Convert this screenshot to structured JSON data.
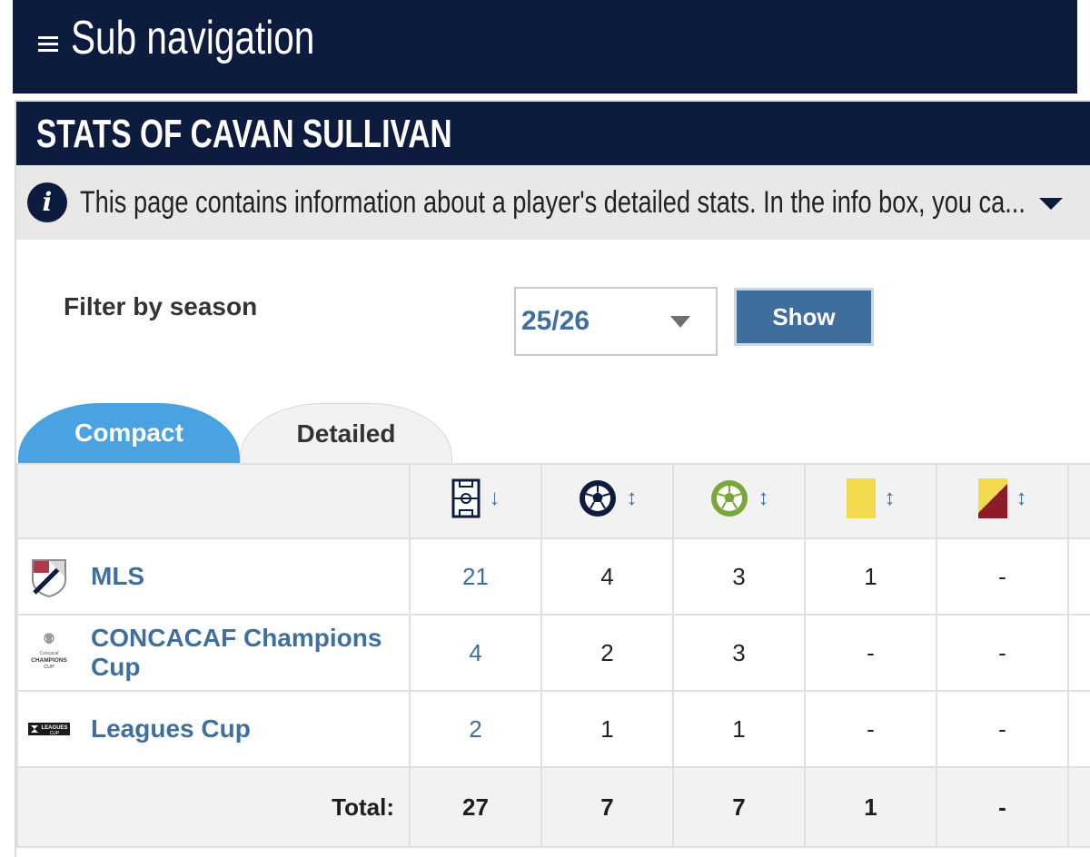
{
  "subnav": {
    "title": "Sub navigation",
    "icon": "hamburger-menu-icon"
  },
  "box": {
    "title": "STATS OF CAVAN SULLIVAN"
  },
  "info": {
    "icon": "info-icon",
    "icon_glyph": "i",
    "text": "This page contains information about a player's detailed stats. In the info box, you ca...",
    "toggle_icon": "caret-down-icon"
  },
  "filter": {
    "label": "Filter by season",
    "selected": "25/26",
    "button": "Show"
  },
  "tabs": [
    {
      "label": "Compact",
      "active": true
    },
    {
      "label": "Detailed",
      "active": false
    }
  ],
  "table": {
    "columns": [
      {
        "icon": "appearances-pitch-icon",
        "sort": "↓"
      },
      {
        "icon": "goals-ball-icon",
        "sort": "↕"
      },
      {
        "icon": "assists-ball-icon",
        "sort": "↕"
      },
      {
        "icon": "yellow-card-icon",
        "sort": "↕"
      },
      {
        "icon": "second-yellow-red-card-icon",
        "sort": "↕"
      }
    ],
    "rows": [
      {
        "competition": "MLS",
        "logo": "mls-logo",
        "values": [
          "21",
          "4",
          "3",
          "1",
          "-"
        ]
      },
      {
        "competition": "CONCACAF Champions Cup",
        "logo": "concacaf-champions-cup-logo",
        "logo_text": [
          "Concacaf",
          "CHAMPIONS",
          "CUP"
        ],
        "values": [
          "4",
          "2",
          "3",
          "-",
          "-"
        ]
      },
      {
        "competition": "Leagues Cup",
        "logo": "leagues-cup-logo",
        "logo_text": [
          "LEAGUES",
          "CUP"
        ],
        "values": [
          "2",
          "1",
          "1",
          "-",
          "-"
        ]
      }
    ],
    "total": {
      "label": "Total:",
      "values": [
        "27",
        "7",
        "7",
        "1",
        "-"
      ]
    }
  },
  "colors": {
    "navy": "#0d1b3e",
    "link_blue": "#3f6f9f",
    "tab_active": "#4aa3e0",
    "yellow_card": "#f2d94e",
    "red_card": "#8c1c2c",
    "ball_green": "#7aa73a"
  }
}
